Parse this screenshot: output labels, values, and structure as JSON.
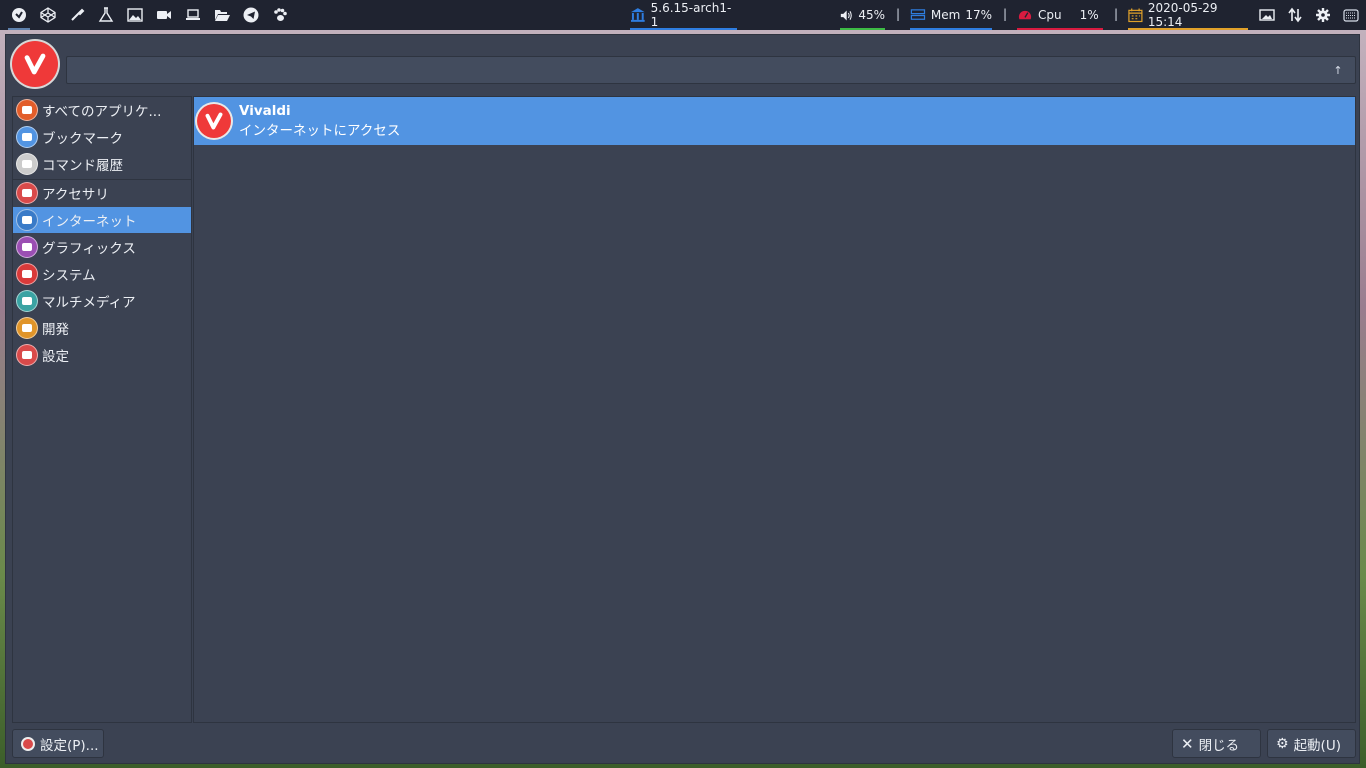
{
  "topbar": {
    "left_icons": [
      "browser-icon",
      "codepen-icon",
      "color-picker-icon",
      "flask-icon",
      "image-icon",
      "video-camera-icon",
      "laptop-icon",
      "folder-open-icon",
      "telegram-icon",
      "paw-icon"
    ],
    "kernel": "5.6.15-arch1-1",
    "volume": "45%",
    "mem_label": "Mem",
    "mem_value": "17%",
    "cpu_label": "Cpu",
    "cpu_value": "1%",
    "datetime": "2020-05-29 15:14",
    "separator": "|",
    "tray_icons": [
      "screenshot-icon",
      "network-arrows-icon",
      "gear-icon",
      "keyboard-icon"
    ]
  },
  "launcher": {
    "search": {
      "value": "",
      "placeholder": ""
    },
    "categories": [
      {
        "label": "すべてのアプリケ...",
        "icon": "all-apps-icon",
        "color": "#e25d2a"
      },
      {
        "label": "ブックマーク",
        "icon": "bookmark-folder-icon",
        "color": "#5294e2"
      },
      {
        "label": "コマンド履歴",
        "icon": "gears-icon",
        "color": "#cccccc"
      },
      {
        "label": "アクセサリ",
        "icon": "accessories-icon",
        "color": "#d94a4a"
      },
      {
        "label": "インターネット",
        "icon": "internet-icon",
        "color": "#3a7bc8"
      },
      {
        "label": "グラフィックス",
        "icon": "graphics-icon",
        "color": "#9b4fb3"
      },
      {
        "label": "システム",
        "icon": "system-icon",
        "color": "#d93a3a"
      },
      {
        "label": "マルチメディア",
        "icon": "multimedia-icon",
        "color": "#3aa3a3"
      },
      {
        "label": "開発",
        "icon": "development-icon",
        "color": "#e0952a"
      },
      {
        "label": "設定",
        "icon": "settings-icon",
        "color": "#d94a4a"
      }
    ],
    "selected_category": "インターネット",
    "apps": [
      {
        "name": "Vivaldi",
        "description": "インターネットにアクセス"
      }
    ],
    "buttons": {
      "settings": "設定(P)...",
      "close": "閉じる",
      "launch": "起動(U)"
    }
  },
  "colors": {
    "accent": "#5294e2",
    "window_bg": "#3b4252",
    "topbar_bg": "#1f2330",
    "vivaldi_red": "#ef3939",
    "volume_ul": "#3dbb45",
    "mem_ul": "#2e7de0",
    "cpu_ul": "#d81b40",
    "date_ul": "#e0a12a"
  }
}
